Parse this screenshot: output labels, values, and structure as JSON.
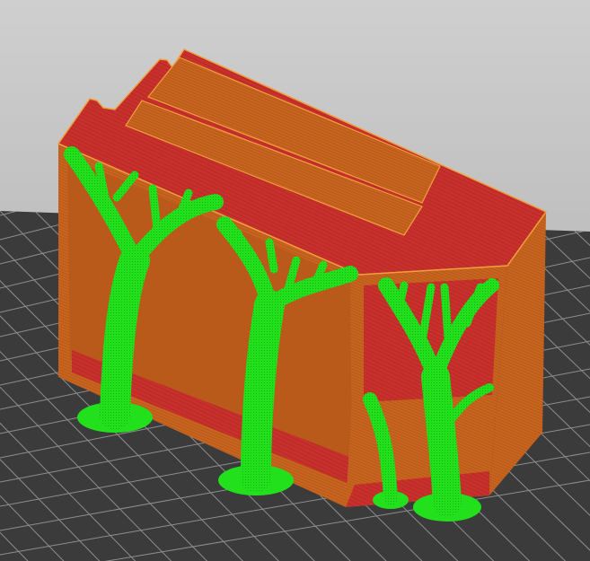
{
  "viewport": {
    "background_top": "#cfcfcf",
    "background_bottom": "#a9a9a9",
    "bed_color": "#3b3b3b",
    "bed_grid_color": "#8e8e8e"
  },
  "model": {
    "perimeter_color": "#c8641e",
    "perimeter_dark": "#a8521a",
    "top_infill_color": "#c8302c",
    "edge_highlight": "#f0a040",
    "support_color": "#22e01c",
    "support_dark": "#14a812"
  }
}
